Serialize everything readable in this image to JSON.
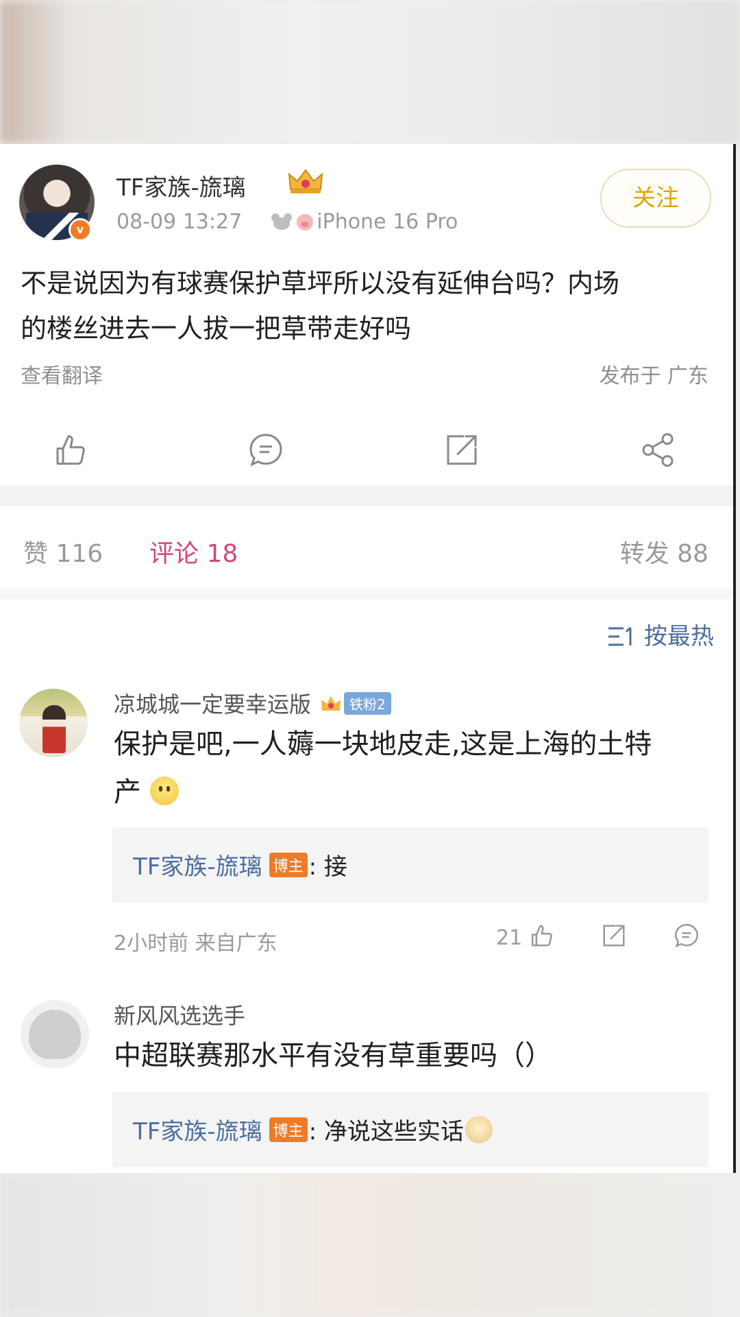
{
  "post": {
    "author": "TF家族-旒璃",
    "verified_mark": "v",
    "time": "08-09 13:27",
    "device": "iPhone 16 Pro",
    "follow_label": "关注",
    "text_line1": "不是说因为有球赛保护草坪所以没有延伸台吗？内场",
    "text_line2": "的楼丝进去一人拔一把草带走好吗",
    "translate_label": "查看翻译",
    "location": "发布于 广东"
  },
  "stats": {
    "likes": "赞 116",
    "comments": "评论 18",
    "reposts": "转发 88"
  },
  "sort": {
    "label": "按最热"
  },
  "comments": [
    {
      "name": "凉城城一定要幸运版",
      "fan_badge": "铁粉2",
      "text_line1": "保护是吧,一人薅一块地皮走,这是上海的土特",
      "text_line2": "产",
      "reply": {
        "name": "TF家族-旒璃",
        "badge": "博主",
        "text": ": 接"
      },
      "time": "2小时前  来自广东",
      "likes": "21"
    },
    {
      "name": "新风风选选手",
      "text": "中超联赛那水平有没有草重要吗（）",
      "reply": {
        "name": "TF家族-旒璃",
        "badge": "博主",
        "text": ": 净说这些实话"
      }
    }
  ],
  "colors": {
    "accent_pink": "#d0487a",
    "link_blue": "#4c6ea0",
    "follow_gold": "#e0a500",
    "badge_orange": "#f07b26"
  }
}
